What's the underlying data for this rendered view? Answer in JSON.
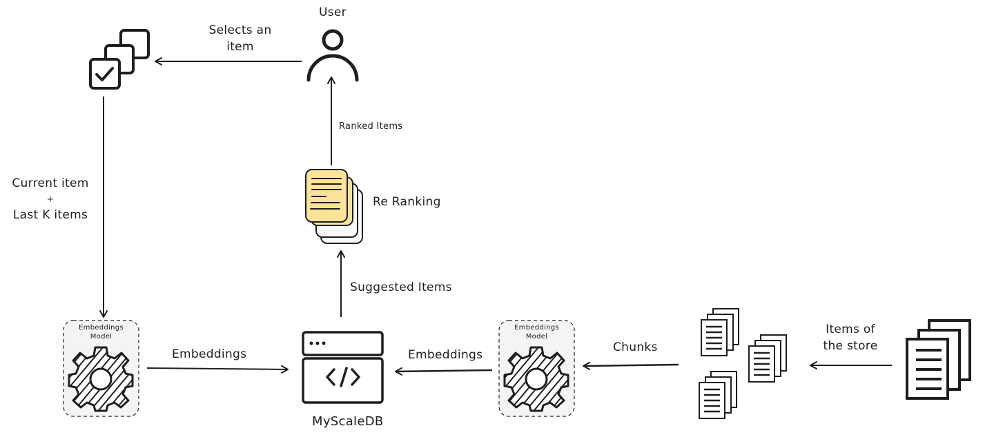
{
  "diagram": {
    "nodes": {
      "user": {
        "label": "User",
        "icon": "user-icon"
      },
      "items_select": {
        "icon": "checklist-stack-icon"
      },
      "re_ranking": {
        "label": "Re Ranking",
        "icon": "stacked-documents-icon",
        "color": "#fbe49a"
      },
      "embeddings_model_left": {
        "label_line1": "Embeddings",
        "label_line2": "Model",
        "icon": "gear-icon",
        "bg": "#f3f4f6"
      },
      "myscaledb": {
        "label": "MyScaleDB",
        "icon": "code-window-icon"
      },
      "embeddings_model_right": {
        "label_line1": "Embeddings",
        "label_line2": "Model",
        "icon": "gear-icon",
        "bg": "#f3f4f6"
      },
      "chunks": {
        "icon": "document-stacks-icon"
      },
      "store_items": {
        "icon": "document-stack-icon"
      }
    },
    "edges": {
      "selects_an_item": {
        "line1": "Selects an",
        "line2": "item"
      },
      "current_last_k": {
        "line1": "Current item",
        "line2": "+",
        "line3": "Last K items"
      },
      "ranked_items": {
        "label": "Ranked Items"
      },
      "suggested_items": {
        "label": "Suggested Items"
      },
      "embeddings_left": {
        "label": "Embeddings"
      },
      "embeddings_right": {
        "label": "Embeddings"
      },
      "chunks": {
        "label": "Chunks"
      },
      "items_of_store": {
        "line1": "Items of",
        "line2": "the store"
      }
    }
  }
}
